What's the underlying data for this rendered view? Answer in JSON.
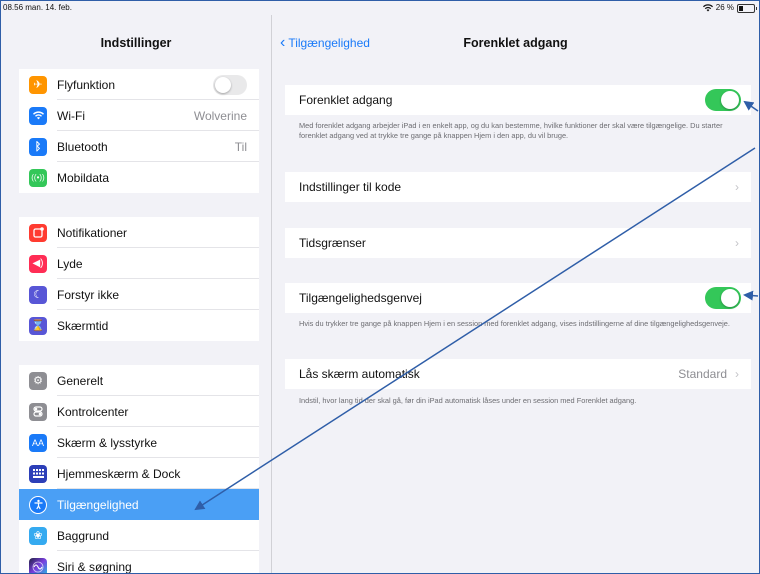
{
  "status": {
    "time": "08.56",
    "date": "man. 14. feb.",
    "wifi_icon": "wifi-icon",
    "battery": "26 %"
  },
  "sidebar": {
    "title": "Indstillinger",
    "groups": [
      [
        {
          "label": "Flyfunktion",
          "icon": "airplane-icon",
          "color": "#ff9500",
          "toggle": false
        },
        {
          "label": "Wi-Fi",
          "icon": "wifi-icon",
          "color": "#1a7af8",
          "value": "Wolverine"
        },
        {
          "label": "Bluetooth",
          "icon": "bluetooth-icon",
          "color": "#1a7af8",
          "value": "Til"
        },
        {
          "label": "Mobildata",
          "icon": "antenna-icon",
          "color": "#34c759"
        }
      ],
      [
        {
          "label": "Notifikationer",
          "icon": "notification-icon",
          "color": "#ff3b30"
        },
        {
          "label": "Lyde",
          "icon": "speaker-icon",
          "color": "#ff2d55"
        },
        {
          "label": "Forstyr ikke",
          "icon": "moon-icon",
          "color": "#5856d6"
        },
        {
          "label": "Skærmtid",
          "icon": "hourglass-icon",
          "color": "#5856d6"
        }
      ],
      [
        {
          "label": "Generelt",
          "icon": "gear-icon",
          "color": "#8e8e93"
        },
        {
          "label": "Kontrolcenter",
          "icon": "switches-icon",
          "color": "#8e8e93"
        },
        {
          "label": "Skærm & lysstyrke",
          "icon": "text-size-icon",
          "color": "#1a7af8"
        },
        {
          "label": "Hjemmeskærm & Dock",
          "icon": "grid-icon",
          "color": "#2c3fb8"
        },
        {
          "label": "Tilgængelighed",
          "icon": "accessibility-icon",
          "color": "#1a7af8",
          "selected": true
        },
        {
          "label": "Baggrund",
          "icon": "flower-icon",
          "color": "#35aaf0"
        },
        {
          "label": "Siri & søgning",
          "icon": "siri-icon",
          "color": "#222244"
        }
      ]
    ]
  },
  "detail": {
    "back_label": "Tilgængelighed",
    "title": "Forenklet adgang",
    "guided_access": {
      "label": "Forenklet adgang",
      "on": true,
      "footnote": "Med forenklet adgang arbejder iPad i en enkelt app, og du kan bestemme, hvilke funktioner der skal være tilgængelige. Du starter forenklet adgang ved at trykke tre gange på knappen Hjem i den app, du vil bruge."
    },
    "passcode_settings": {
      "label": "Indstillinger til kode"
    },
    "time_limits": {
      "label": "Tidsgrænser"
    },
    "accessibility_shortcut": {
      "label": "Tilgængelighedsgenvej",
      "on": true,
      "footnote": "Hvis du trykker tre gange på knappen Hjem i en session med forenklet adgang, vises indstillingerne af dine tilgængelighedsgenveje."
    },
    "auto_lock": {
      "label": "Lås skærm automatisk",
      "value": "Standard",
      "footnote": "Indstil, hvor lang tid der skal gå, før din iPad automatisk låses under en session med Forenklet adgang."
    }
  },
  "colors": {
    "accent": "#1a7af8",
    "selected_row": "#4a9ff5",
    "toggle_on": "#34c759",
    "annotation_arrow": "#2f5ea8"
  }
}
